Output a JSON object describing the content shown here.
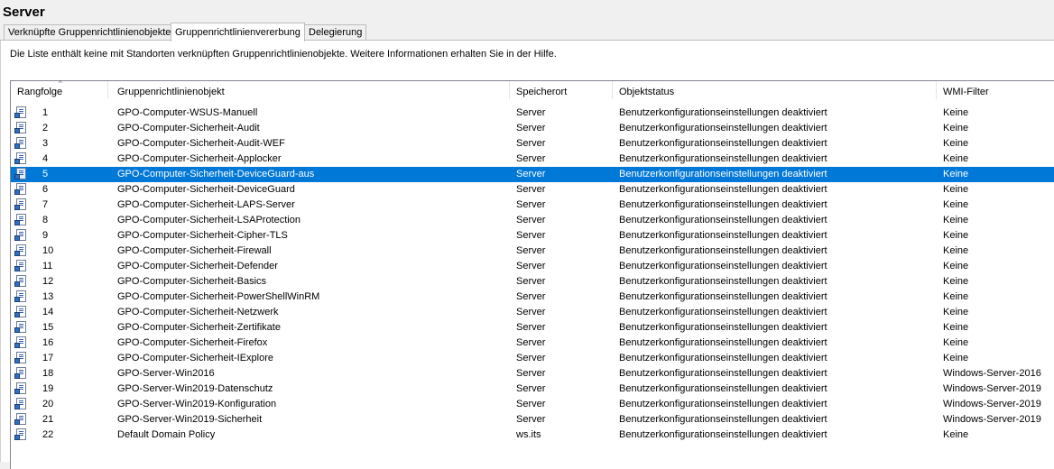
{
  "header": {
    "title": "Server"
  },
  "tabs": [
    {
      "label": "Verknüpfte Gruppenrichtlinienobjekte",
      "active": false
    },
    {
      "label": "Gruppenrichtlinienvererbung",
      "active": true
    },
    {
      "label": "Delegierung",
      "active": false
    }
  ],
  "info_text": "Die Liste enthält keine mit Standorten verknüpften Gruppenrichtlinienobjekte. Weitere Informationen erhalten Sie in der Hilfe.",
  "table": {
    "columns": {
      "rank": "Rangfolge",
      "gpo": "Gruppenrichtlinienobjekt",
      "location": "Speicherort",
      "status": "Objektstatus",
      "wmi": "WMI-Filter"
    },
    "sort_indicator": "^",
    "row_icon": "gpo-icon",
    "selected_row": 4,
    "rows": [
      {
        "rank": "1",
        "gpo": "GPO-Computer-WSUS-Manuell",
        "location": "Server",
        "status": "Benutzerkonfigurationseinstellungen deaktiviert",
        "wmi": "Keine"
      },
      {
        "rank": "2",
        "gpo": "GPO-Computer-Sicherheit-Audit",
        "location": "Server",
        "status": "Benutzerkonfigurationseinstellungen deaktiviert",
        "wmi": "Keine"
      },
      {
        "rank": "3",
        "gpo": "GPO-Computer-Sicherheit-Audit-WEF",
        "location": "Server",
        "status": "Benutzerkonfigurationseinstellungen deaktiviert",
        "wmi": "Keine"
      },
      {
        "rank": "4",
        "gpo": "GPO-Computer-Sicherheit-Applocker",
        "location": "Server",
        "status": "Benutzerkonfigurationseinstellungen deaktiviert",
        "wmi": "Keine"
      },
      {
        "rank": "5",
        "gpo": "GPO-Computer-Sicherheit-DeviceGuard-aus",
        "location": "Server",
        "status": "Benutzerkonfigurationseinstellungen deaktiviert",
        "wmi": "Keine"
      },
      {
        "rank": "6",
        "gpo": "GPO-Computer-Sicherheit-DeviceGuard",
        "location": "Server",
        "status": "Benutzerkonfigurationseinstellungen deaktiviert",
        "wmi": "Keine"
      },
      {
        "rank": "7",
        "gpo": "GPO-Computer-Sicherheit-LAPS-Server",
        "location": "Server",
        "status": "Benutzerkonfigurationseinstellungen deaktiviert",
        "wmi": "Keine"
      },
      {
        "rank": "8",
        "gpo": "GPO-Computer-Sicherheit-LSAProtection",
        "location": "Server",
        "status": "Benutzerkonfigurationseinstellungen deaktiviert",
        "wmi": "Keine"
      },
      {
        "rank": "9",
        "gpo": "GPO-Computer-Sicherheit-Cipher-TLS",
        "location": "Server",
        "status": "Benutzerkonfigurationseinstellungen deaktiviert",
        "wmi": "Keine"
      },
      {
        "rank": "10",
        "gpo": "GPO-Computer-Sicherheit-Firewall",
        "location": "Server",
        "status": "Benutzerkonfigurationseinstellungen deaktiviert",
        "wmi": "Keine"
      },
      {
        "rank": "11",
        "gpo": "GPO-Computer-Sicherheit-Defender",
        "location": "Server",
        "status": "Benutzerkonfigurationseinstellungen deaktiviert",
        "wmi": "Keine"
      },
      {
        "rank": "12",
        "gpo": "GPO-Computer-Sicherheit-Basics",
        "location": "Server",
        "status": "Benutzerkonfigurationseinstellungen deaktiviert",
        "wmi": "Keine"
      },
      {
        "rank": "13",
        "gpo": "GPO-Computer-Sicherheit-PowerShellWinRM",
        "location": "Server",
        "status": "Benutzerkonfigurationseinstellungen deaktiviert",
        "wmi": "Keine"
      },
      {
        "rank": "14",
        "gpo": "GPO-Computer-Sicherheit-Netzwerk",
        "location": "Server",
        "status": "Benutzerkonfigurationseinstellungen deaktiviert",
        "wmi": "Keine"
      },
      {
        "rank": "15",
        "gpo": "GPO-Computer-Sicherheit-Zertifikate",
        "location": "Server",
        "status": "Benutzerkonfigurationseinstellungen deaktiviert",
        "wmi": "Keine"
      },
      {
        "rank": "16",
        "gpo": "GPO-Computer-Sicherheit-Firefox",
        "location": "Server",
        "status": "Benutzerkonfigurationseinstellungen deaktiviert",
        "wmi": "Keine"
      },
      {
        "rank": "17",
        "gpo": "GPO-Computer-Sicherheit-IExplore",
        "location": "Server",
        "status": "Benutzerkonfigurationseinstellungen deaktiviert",
        "wmi": "Keine"
      },
      {
        "rank": "18",
        "gpo": "GPO-Server-Win2016",
        "location": "Server",
        "status": "Benutzerkonfigurationseinstellungen deaktiviert",
        "wmi": "Windows-Server-2016"
      },
      {
        "rank": "19",
        "gpo": "GPO-Server-Win2019-Datenschutz",
        "location": "Server",
        "status": "Benutzerkonfigurationseinstellungen deaktiviert",
        "wmi": "Windows-Server-2019"
      },
      {
        "rank": "20",
        "gpo": "GPO-Server-Win2019-Konfiguration",
        "location": "Server",
        "status": "Benutzerkonfigurationseinstellungen deaktiviert",
        "wmi": "Windows-Server-2019"
      },
      {
        "rank": "21",
        "gpo": "GPO-Server-Win2019-Sicherheit",
        "location": "Server",
        "status": "Benutzerkonfigurationseinstellungen deaktiviert",
        "wmi": "Windows-Server-2019"
      },
      {
        "rank": "22",
        "gpo": "Default Domain Policy",
        "location": "ws.its",
        "status": "Benutzerkonfigurationseinstellungen deaktiviert",
        "wmi": "Keine"
      }
    ]
  }
}
